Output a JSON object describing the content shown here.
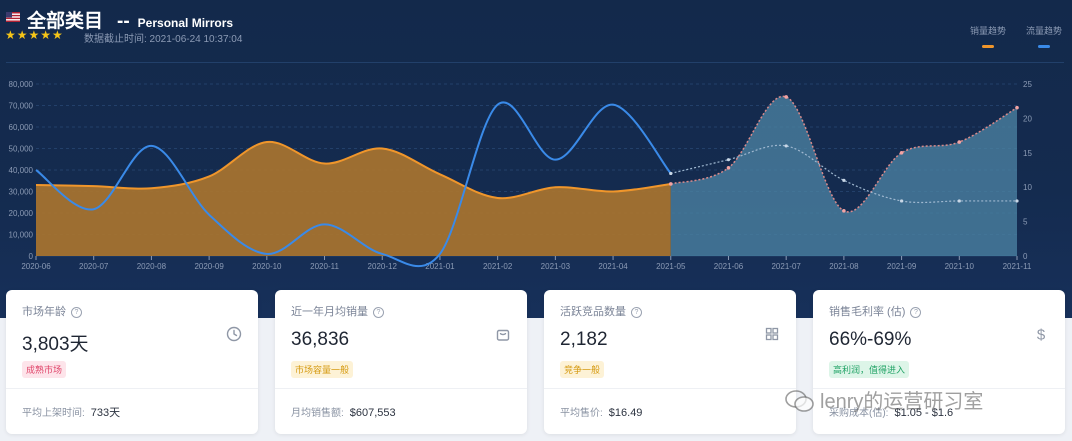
{
  "header": {
    "flag_icon": "us-flag-icon",
    "title": "全部类目",
    "separator": "--",
    "subtitle": "Personal Mirrors",
    "stars": "★★★★★",
    "as_of": "数据截止时间: 2021-06-24 10:37:04",
    "legend": [
      {
        "label": "销量趋势",
        "color": "#f0962b"
      },
      {
        "label": "流量趋势",
        "color": "#3a8ae8"
      }
    ]
  },
  "chart_data": {
    "type": "area",
    "x": [
      "2020-06",
      "2020-07",
      "2020-08",
      "2020-09",
      "2020-10",
      "2020-11",
      "2020-12",
      "2021-01",
      "2021-02",
      "2021-03",
      "2021-04",
      "2021-05",
      "2021-06",
      "2021-07",
      "2021-08",
      "2021-09",
      "2021-10",
      "2021-11"
    ],
    "y_left": {
      "ticks": [
        "0",
        "10,000",
        "20,000",
        "30,000",
        "40,000",
        "50,000",
        "60,000",
        "70,000",
        "80,000"
      ],
      "ylim": [
        0,
        80000
      ]
    },
    "y_right": {
      "ticks": [
        "0",
        "5",
        "10",
        "15",
        "20",
        "25"
      ],
      "ylim": [
        0,
        25
      ]
    },
    "series": [
      {
        "name": "销量趋势",
        "axis": "left",
        "color": "#f0962b",
        "values": [
          33000,
          32500,
          31500,
          37000,
          53000,
          43000,
          50000,
          38000,
          27000,
          32000,
          30000,
          33500,
          41000,
          74000,
          21000,
          48000,
          53000,
          69000
        ],
        "forecast_from": "2021-05"
      },
      {
        "name": "流量趋势",
        "axis": "right",
        "color": "#3a8ae8",
        "values": [
          12.5,
          6.8,
          16,
          6,
          0.3,
          4.6,
          0.3,
          0.3,
          22,
          14,
          22,
          12,
          14,
          16,
          11,
          8,
          8,
          8
        ],
        "forecast_from": "2021-05"
      }
    ],
    "grid": true
  },
  "cards": [
    {
      "label": "市场年龄",
      "value": "3,803天",
      "icon": "clock-icon",
      "tag": "成熟市场",
      "tag_bg": "#fde4ea",
      "tag_color": "#e0466b",
      "foot_label": "平均上架时间:",
      "foot_value": "733天"
    },
    {
      "label": "近一年月均销量",
      "value": "36,836",
      "icon": "shopping-bag-icon",
      "tag": "市场容量一般",
      "tag_bg": "#fdf2d6",
      "tag_color": "#d59a10",
      "foot_label": "月均销售额:",
      "foot_value": "$607,553"
    },
    {
      "label": "活跃竞品数量",
      "value": "2,182",
      "icon": "grid-icon",
      "tag": "竞争一般",
      "tag_bg": "#fdf2d6",
      "tag_color": "#d59a10",
      "foot_label": "平均售价:",
      "foot_value": "$16.49"
    },
    {
      "label": "销售毛利率 (估)",
      "value": "66%-69%",
      "icon": "dollar-icon",
      "tag": "高利润，值得进入",
      "tag_bg": "#ddf5e8",
      "tag_color": "#21a366",
      "foot_label": "采购成本(估):",
      "foot_value": "$1.05 - $1.6"
    }
  ],
  "watermark": {
    "text": "lenry的运营研习室",
    "icon": "wechat-icon"
  }
}
